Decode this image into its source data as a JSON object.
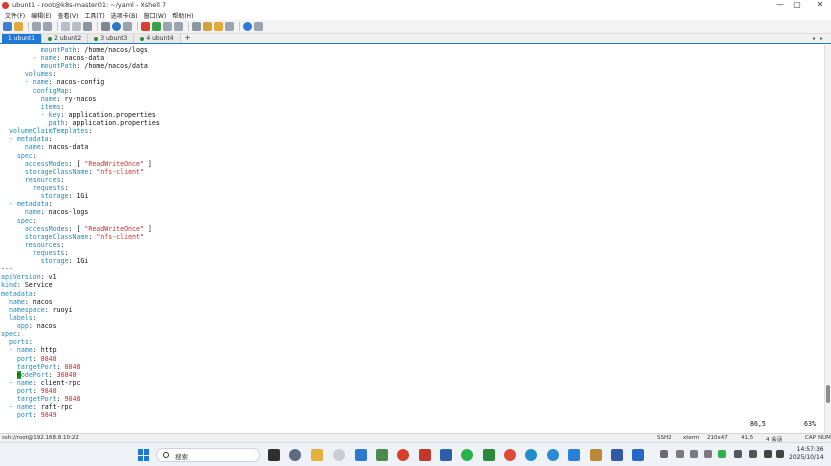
{
  "window": {
    "title": "ubunt1 - root@k8s-master01: ~/yaml - Xshell 7",
    "controls": [
      "—",
      "▢",
      "✕"
    ]
  },
  "menu": [
    "文件(F)",
    "编辑(E)",
    "查看(V)",
    "工具(T)",
    "选项卡(B)",
    "窗口(W)",
    "帮助(H)"
  ],
  "tabs": {
    "items": [
      {
        "label": "1 ubunt1",
        "active": true
      },
      {
        "label": "2 ubunt2",
        "active": false
      },
      {
        "label": "3 ubunt3",
        "active": false
      },
      {
        "label": "4 ubunt4",
        "active": false
      }
    ],
    "add": "+"
  },
  "terminal": {
    "lines": [
      [
        [
          "          ",
          ""
        ],
        [
          "mountPath",
          "k"
        ],
        [
          ": /home/nacos/logs",
          ""
        ]
      ],
      [
        [
          "        - ",
          "d"
        ],
        [
          "name",
          "k"
        ],
        [
          ": nacos-data",
          ""
        ]
      ],
      [
        [
          "          ",
          ""
        ],
        [
          "mountPath",
          "k"
        ],
        [
          ": /home/nacos/data",
          ""
        ]
      ],
      [
        [
          "      ",
          ""
        ],
        [
          "volumes",
          "k"
        ],
        [
          ":",
          ""
        ]
      ],
      [
        [
          "      - ",
          "d"
        ],
        [
          "name",
          "k"
        ],
        [
          ": nacos-config",
          ""
        ]
      ],
      [
        [
          "        ",
          ""
        ],
        [
          "configMap",
          "k"
        ],
        [
          ":",
          ""
        ]
      ],
      [
        [
          "          ",
          ""
        ],
        [
          "name",
          "k"
        ],
        [
          ": ry-nacos",
          ""
        ]
      ],
      [
        [
          "          ",
          ""
        ],
        [
          "items",
          "k"
        ],
        [
          ":",
          ""
        ]
      ],
      [
        [
          "          - ",
          "d"
        ],
        [
          "key",
          "k"
        ],
        [
          ": application.properties",
          ""
        ]
      ],
      [
        [
          "            ",
          ""
        ],
        [
          "path",
          "k"
        ],
        [
          ": application.properties",
          ""
        ]
      ],
      [
        [
          "  ",
          ""
        ],
        [
          "volumeClaimTemplates",
          "k"
        ],
        [
          ":",
          ""
        ]
      ],
      [
        [
          "  - ",
          "d"
        ],
        [
          "metadata",
          "k"
        ],
        [
          ":",
          ""
        ]
      ],
      [
        [
          "      ",
          ""
        ],
        [
          "name",
          "k"
        ],
        [
          ": nacos-data",
          ""
        ]
      ],
      [
        [
          "    ",
          ""
        ],
        [
          "spec",
          "k"
        ],
        [
          ":",
          ""
        ]
      ],
      [
        [
          "      ",
          ""
        ],
        [
          "accessModes",
          "k"
        ],
        [
          ": [ ",
          ""
        ],
        [
          "\"ReadWriteOnce\"",
          "s"
        ],
        [
          " ]",
          ""
        ]
      ],
      [
        [
          "      ",
          ""
        ],
        [
          "storageClassName",
          "k"
        ],
        [
          ": ",
          ""
        ],
        [
          "\"nfs-client\"",
          "s"
        ]
      ],
      [
        [
          "      ",
          ""
        ],
        [
          "resources",
          "k"
        ],
        [
          ":",
          ""
        ]
      ],
      [
        [
          "        ",
          ""
        ],
        [
          "requests",
          "k"
        ],
        [
          ":",
          ""
        ]
      ],
      [
        [
          "          ",
          ""
        ],
        [
          "storage",
          "k"
        ],
        [
          ": 1Gi",
          ""
        ]
      ],
      [
        [
          "  - ",
          "d"
        ],
        [
          "metadata",
          "k"
        ],
        [
          ":",
          ""
        ]
      ],
      [
        [
          "      ",
          ""
        ],
        [
          "name",
          "k"
        ],
        [
          ": nacos-logs",
          ""
        ]
      ],
      [
        [
          "    ",
          ""
        ],
        [
          "spec",
          "k"
        ],
        [
          ":",
          ""
        ]
      ],
      [
        [
          "      ",
          ""
        ],
        [
          "accessModes",
          "k"
        ],
        [
          ": [ ",
          ""
        ],
        [
          "\"ReadWriteOnce\"",
          "s"
        ],
        [
          " ]",
          ""
        ]
      ],
      [
        [
          "      ",
          ""
        ],
        [
          "storageClassName",
          "k"
        ],
        [
          ": ",
          ""
        ],
        [
          "\"nfs-client\"",
          "s"
        ]
      ],
      [
        [
          "      ",
          ""
        ],
        [
          "resources",
          "k"
        ],
        [
          ":",
          ""
        ]
      ],
      [
        [
          "        ",
          ""
        ],
        [
          "requests",
          "k"
        ],
        [
          ":",
          ""
        ]
      ],
      [
        [
          "          ",
          ""
        ],
        [
          "storage",
          "k"
        ],
        [
          ": 1Gi",
          ""
        ]
      ],
      [
        [
          "---",
          "blue"
        ]
      ],
      [
        [
          "apiVersion",
          "k"
        ],
        [
          ": v1",
          ""
        ]
      ],
      [
        [
          "kind",
          "k"
        ],
        [
          ": Service",
          ""
        ]
      ],
      [
        [
          "metadata",
          "k"
        ],
        [
          ":",
          ""
        ]
      ],
      [
        [
          "  ",
          ""
        ],
        [
          "name",
          "k"
        ],
        [
          ": nacos",
          ""
        ]
      ],
      [
        [
          "  ",
          ""
        ],
        [
          "namespace",
          "k"
        ],
        [
          ": ruoyi",
          ""
        ]
      ],
      [
        [
          "  ",
          ""
        ],
        [
          "labels",
          "k"
        ],
        [
          ":",
          ""
        ]
      ],
      [
        [
          "    ",
          ""
        ],
        [
          "app",
          "k"
        ],
        [
          ": nacos",
          ""
        ]
      ],
      [
        [
          "spec",
          "k"
        ],
        [
          ":",
          ""
        ]
      ],
      [
        [
          "  ",
          ""
        ],
        [
          "ports",
          "k"
        ],
        [
          ":",
          ""
        ]
      ],
      [
        [
          "  - ",
          "d"
        ],
        [
          "name",
          "k"
        ],
        [
          ": http",
          ""
        ]
      ],
      [
        [
          "    ",
          ""
        ],
        [
          "port",
          "k"
        ],
        [
          ": ",
          ""
        ],
        [
          "8848",
          "n"
        ]
      ],
      [
        [
          "    ",
          ""
        ],
        [
          "targetPort",
          "k"
        ],
        [
          ": ",
          ""
        ],
        [
          "8848",
          "n"
        ]
      ],
      [
        [
          "    ",
          ""
        ],
        [
          "n",
          "cursor"
        ],
        [
          "odePort",
          "k"
        ],
        [
          ": ",
          ""
        ],
        [
          "30848",
          "n"
        ]
      ],
      [
        [
          "  - ",
          "d"
        ],
        [
          "name",
          "k"
        ],
        [
          ": client-rpc",
          ""
        ]
      ],
      [
        [
          "    ",
          ""
        ],
        [
          "port",
          "k"
        ],
        [
          ": ",
          ""
        ],
        [
          "9848",
          "n"
        ]
      ],
      [
        [
          "    ",
          ""
        ],
        [
          "targetPort",
          "k"
        ],
        [
          ": ",
          ""
        ],
        [
          "9848",
          "n"
        ]
      ],
      [
        [
          "  - ",
          "d"
        ],
        [
          "name",
          "k"
        ],
        [
          ": raft-rpc",
          ""
        ]
      ],
      [
        [
          "    ",
          ""
        ],
        [
          "port",
          "k"
        ],
        [
          ": ",
          ""
        ],
        [
          "9849",
          "n"
        ]
      ]
    ],
    "cursor_pos": "86,5",
    "scroll_pct": "63%",
    "scroll_fraction": 0.92
  },
  "status": {
    "connection": "ssh://root@192.168.8.10:22",
    "protocol": "SSH2",
    "terminal_type": "xterm",
    "size": "210x47",
    "cursor": "41,5",
    "sessions": "4 会话",
    "caps": "CAP",
    "num": "NUM"
  },
  "taskbar": {
    "search_label": "搜索",
    "time": "14:57:36",
    "date": "2025/10/14"
  },
  "colors": {
    "tab_active": "#1e78d6",
    "yaml_key": "#1d8ec0",
    "yaml_string": "#d22d2d",
    "cursor": "#1aa81a"
  }
}
